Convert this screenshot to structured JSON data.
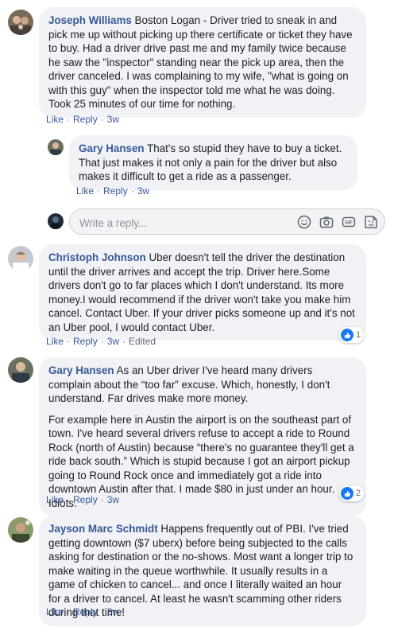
{
  "comments": [
    {
      "author": "Joseph Williams",
      "text": " Boston Logan - Driver tried to sneak in and pick me up without picking up there certificate or ticket they have to buy. Had a driver drive past me and my family twice because he saw the \"inspector\" standing near the pick up area, then the driver canceled. I was complaining to my wife, \"what is going on with this guy\" when the inspector told me what he was doing. Took 25 minutes of our time for nothing.",
      "like": "Like",
      "reply": "Reply",
      "time": "3w"
    },
    {
      "author": "Gary Hansen",
      "text": " That's so stupid they have to buy a ticket. That just makes it not only a pain for the driver but also makes it difficult to get a ride as a passenger.",
      "like": "Like",
      "reply": "Reply",
      "time": "3w"
    },
    {
      "author": "Christoph Johnson",
      "text": " Uber doesn't tell the driver the destination until the driver arrives and accept the trip. Driver here.Some drivers don't go to far places which I don't understand. Its more money.I would recommend if the driver won't take you make him cancel. Contact Uber. If your driver picks someone up and it's not an Uber pool, I would contact Uber.",
      "like": "Like",
      "reply": "Reply",
      "time": "3w",
      "edited": "Edited",
      "reactions": "1"
    },
    {
      "author": "Gary Hansen",
      "text": " As an Uber driver I've heard many drivers complain about the “too far” excuse. Which, honestly, I don't understand. Far drives make more money.",
      "text2": "For example here in Austin the airport is on the southeast part of town. I've heard several drivers refuse to accept a ride to Round Rock (north of Austin) because “there's no guarantee they'll get a ride back south.” Which is stupid because I got an airport pickup going to Round Rock once and immediately got a ride into downtown Austin after that. I made $80 in just under an hour. Idiots.",
      "like": "Like",
      "reply": "Reply",
      "time": "3w",
      "reactions": "2"
    },
    {
      "author": "Jayson Marc Schmidt",
      "text": " Happens frequently out of PBI. I've tried getting downtown ($7 uberx) before being subjected to the calls asking for destination or the no-shows. Most want a longer trip to make waiting in the queue worthwhile. It usually results in a game of chicken to cancel... and once I literally waited an hour for a driver to cancel. At least he wasn't scamming other riders during that time!",
      "like": "Like",
      "reply": "Reply",
      "time": "3w"
    }
  ],
  "reply_box": {
    "placeholder": "Write a reply...",
    "icons": [
      "emoji-icon",
      "camera-icon",
      "gif-icon",
      "sticker-icon"
    ]
  },
  "colors": {
    "author": "#385898",
    "bubble": "#f0f2f5",
    "meta": "#606770",
    "like_blue": "#1877f2"
  }
}
